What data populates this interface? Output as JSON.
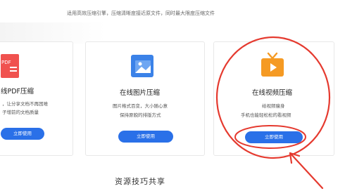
{
  "header": {
    "tagline": "适用高效压缩引擎，压缩清晰度接近原文件，同时最大限度压缩文件"
  },
  "cards": [
    {
      "title": "线PDF压缩",
      "desc_lines": [
        "，让分享文档不再困难",
        "子增前的文档质量"
      ],
      "button_label": "立即使用",
      "icon_name": "pdf-icon",
      "icon_text": "PDF"
    },
    {
      "title": "在线图片压缩",
      "desc_lines": [
        "图片格式百变，大小随心意",
        "保持原貌的排版方式"
      ],
      "button_label": "立即使用",
      "icon_name": "image-icon"
    },
    {
      "title": "在线视频压缩",
      "desc_lines": [
        "给视频瘦身",
        "手机也能轻松松的看视频"
      ],
      "button_label": "立即使用",
      "icon_name": "video-tv-icon"
    }
  ],
  "section": {
    "title": "资源技巧共享"
  },
  "colors": {
    "accent": "#2a70e8",
    "annotation": "#e53a2f",
    "pdf_icon": "#f0524f",
    "image_icon": "#3b82e8",
    "video_icon": "#f59a23"
  }
}
